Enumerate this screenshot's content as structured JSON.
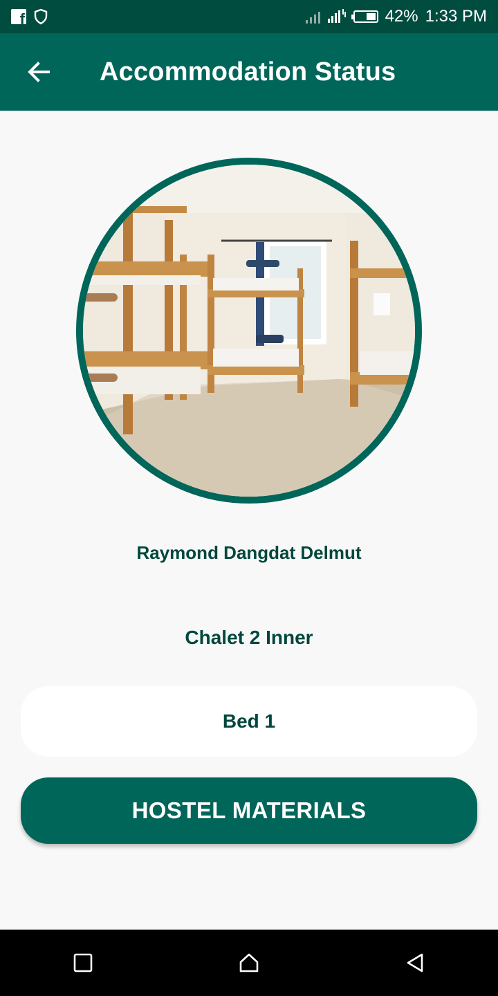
{
  "status_bar": {
    "battery_percent": "42%",
    "time": "1:33 PM",
    "icons": [
      "facebook-icon",
      "shield-icon",
      "signal-icon",
      "data-icon",
      "battery-icon"
    ]
  },
  "app_bar": {
    "title": "Accommodation Status",
    "back_icon": "arrow-back-icon"
  },
  "profile": {
    "photo": "dormitory-bunk-beds-photo",
    "name": "Raymond Dangdat Delmut",
    "room": "Chalet 2 Inner",
    "bed": "Bed 1"
  },
  "actions": {
    "hostel_materials": "HOSTEL MATERIALS"
  },
  "nav_bar": {
    "icons": [
      "recent-apps-icon",
      "home-icon",
      "back-triangle-icon"
    ]
  },
  "colors": {
    "status_bar": "#004d40",
    "primary": "#00665a",
    "text_dark": "#00473d",
    "background": "#f8f8f8"
  }
}
